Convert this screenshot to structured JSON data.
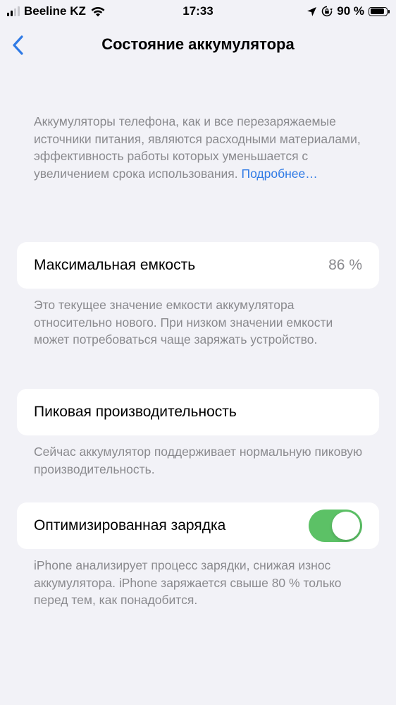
{
  "status_bar": {
    "carrier": "Beeline KZ",
    "time": "17:33",
    "battery_percent": "90 %",
    "battery_level": 0.9
  },
  "nav": {
    "title": "Состояние аккумулятора"
  },
  "intro": {
    "text": "Аккумуляторы телефона, как и все перезаряжаемые источники питания, являются расходными материалами, эффективность работы которых уменьшается с увеличением срока использования.",
    "link": "Подробнее…"
  },
  "max_capacity": {
    "label": "Максимальная емкость",
    "value": "86 %",
    "footer": "Это текущее значение емкости аккумулятора относительно нового. При низком значении емкости может потребоваться чаще заряжать устройство."
  },
  "peak_performance": {
    "label": "Пиковая производительность",
    "footer": "Сейчас аккумулятор поддерживает нормальную пиковую производительность."
  },
  "optimized_charging": {
    "label": "Оптимизированная зарядка",
    "enabled": true,
    "footer": "iPhone анализирует процесс зарядки, снижая износ аккумулятора. iPhone заряжается свыше 80 % только перед тем, как понадобится."
  },
  "colors": {
    "accent": "#2f7ae5",
    "toggle_on": "#5cc166",
    "background": "#f2f2f7",
    "secondary_text": "#8a8a8e"
  }
}
